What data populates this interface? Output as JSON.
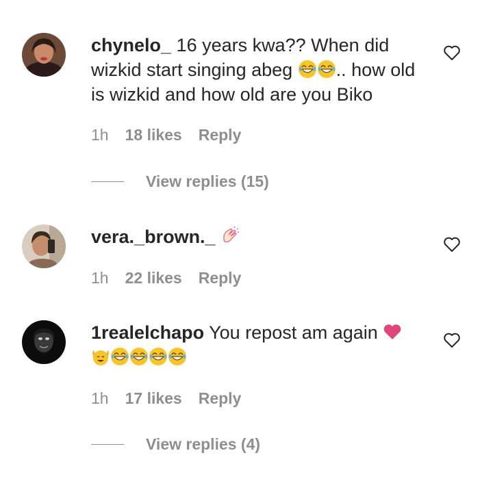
{
  "comments": [
    {
      "username": "chynelo_",
      "text_before": " 16 years kwa?? When did wizkid start singing abeg ",
      "text_after": ".. how old is wizkid and how old are you Biko",
      "emojis": [
        "joy-emoji",
        "joy-emoji"
      ],
      "time": "1h",
      "likes": "18 likes",
      "reply": "Reply",
      "view_replies": "View replies (15)"
    },
    {
      "username": "vera._brown._",
      "text_before": " ",
      "emojis": [
        "clapping-hands-emoji"
      ],
      "time": "1h",
      "likes": "22 likes",
      "reply": "Reply"
    },
    {
      "username": "1realelchapo",
      "text_before": " You repost am again ",
      "emojis": [
        "heart-emoji",
        "raising-hands-face-emoji",
        "joy-emoji",
        "joy-emoji",
        "joy-emoji",
        "joy-emoji"
      ],
      "time": "1h",
      "likes": "17 likes",
      "reply": "Reply",
      "view_replies": "View replies (4)"
    }
  ],
  "colors": {
    "text": "#262626",
    "meta": "#8e8e8e",
    "heart_outline": "#262626",
    "emoji_yellow": "#f7c52a",
    "heart_pink": "#e0457b"
  }
}
